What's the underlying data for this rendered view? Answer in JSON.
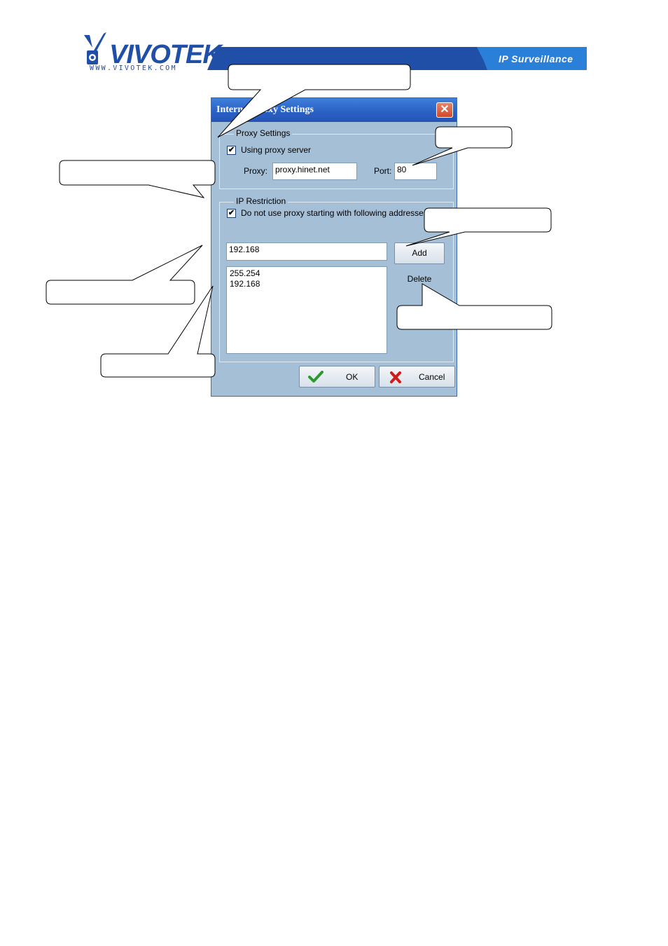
{
  "header": {
    "brand": "VIVOTEK",
    "website": "WWW.VIVOTEK.COM",
    "tagline": "IP Surveillance",
    "brand_color": "#1f4fa6"
  },
  "dialog": {
    "title": "Internet Proxy Settings",
    "close_glyph": "✕",
    "proxy_settings": {
      "group_label": "Proxy Settings",
      "use_proxy_label": "Using proxy server",
      "use_proxy_checked": true,
      "proxy_label": "Proxy:",
      "proxy_value": "proxy.hinet.net",
      "port_label": "Port:",
      "port_value": "80"
    },
    "ip_restriction": {
      "group_label": "IP Restriction",
      "no_proxy_label": "Do not use proxy starting with following addresses",
      "no_proxy_checked": true,
      "address_input": "192.168",
      "add_label": "Add",
      "delete_label": "Delete",
      "addresses": [
        "255.254",
        "192.168"
      ]
    },
    "ok_label": "OK",
    "cancel_label": "Cancel",
    "check_glyph": "✔",
    "ok_icon": "check-icon",
    "cancel_icon": "x-icon"
  }
}
